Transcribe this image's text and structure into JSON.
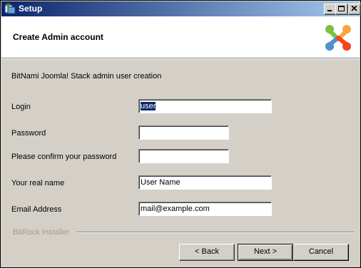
{
  "window": {
    "title": "Setup",
    "controls": {
      "minimize": "minimize",
      "maximize": "maximize",
      "close": "close"
    }
  },
  "header": {
    "title": "Create Admin account",
    "logo": "joomla-logo"
  },
  "form": {
    "subtitle": "BitNami Joomla! Stack admin user creation",
    "fields": {
      "login": {
        "label": "Login",
        "value": "user"
      },
      "password": {
        "label": "Password",
        "value": ""
      },
      "confirm_password": {
        "label": "Please confirm your password",
        "value": ""
      },
      "real_name": {
        "label": "Your real name",
        "value": "User Name"
      },
      "email": {
        "label": "Email Address",
        "value": "mail@example.com"
      }
    }
  },
  "footer": {
    "brand": "BitRock Installer",
    "buttons": {
      "back": "< Back",
      "next": "Next >",
      "cancel": "Cancel"
    }
  },
  "colors": {
    "titlebar_start": "#0a246a",
    "titlebar_end": "#a6caf0",
    "dialog_bg": "#d4d0c8",
    "header_bg": "#ffffff"
  }
}
